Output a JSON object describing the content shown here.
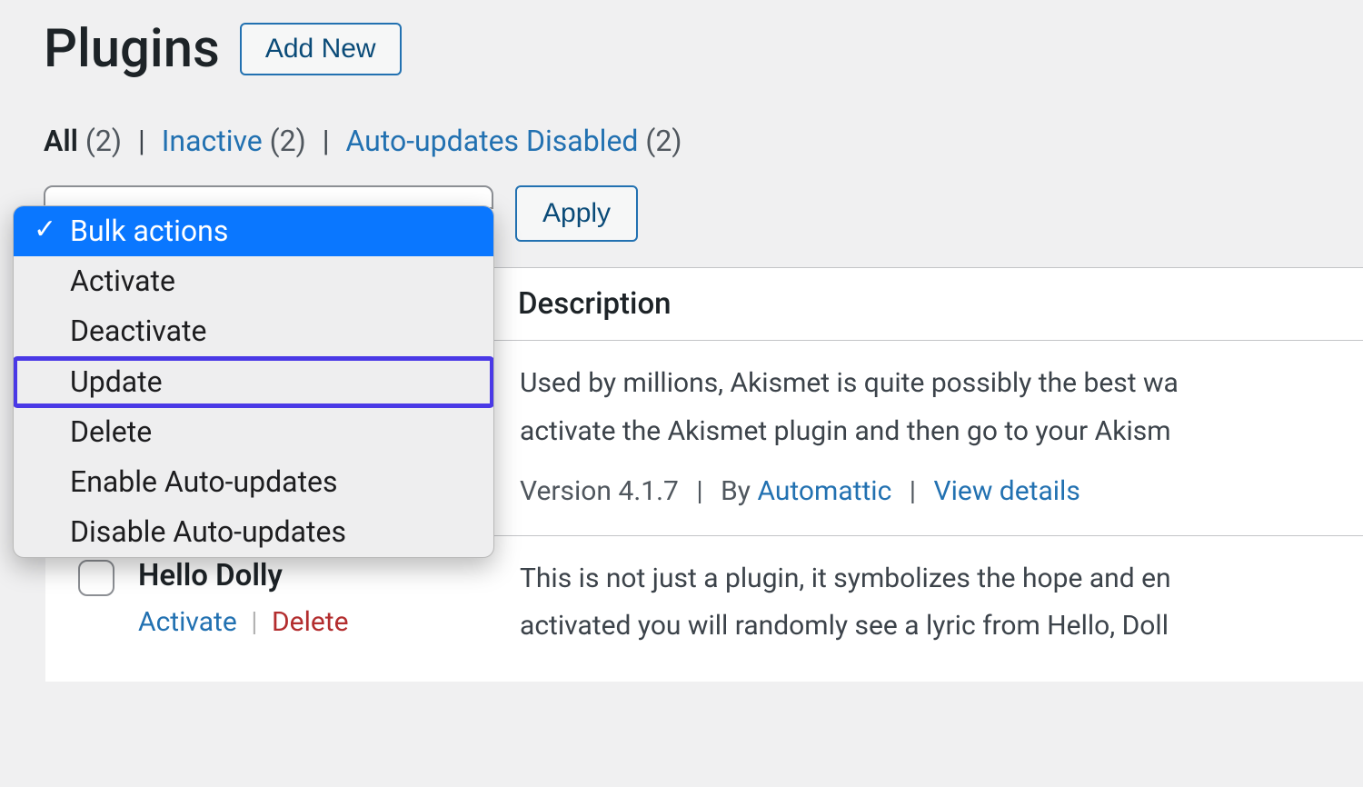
{
  "header": {
    "title": "Plugins",
    "add_new_label": "Add New"
  },
  "filters": {
    "all": {
      "label": "All",
      "count": "(2)"
    },
    "inactive": {
      "label": "Inactive",
      "count": "(2)"
    },
    "auto_updates_disabled": {
      "label": "Auto-updates Disabled",
      "count": "(2)"
    }
  },
  "bulk_actions": {
    "apply_label": "Apply",
    "options": {
      "bulk_actions": "Bulk actions",
      "activate": "Activate",
      "deactivate": "Deactivate",
      "update": "Update",
      "delete": "Delete",
      "enable_auto_updates": "Enable Auto-updates",
      "disable_auto_updates": "Disable Auto-updates"
    }
  },
  "table": {
    "header_description": "Description"
  },
  "plugins": {
    "akismet": {
      "desc_line1": "Used by millions, Akismet is quite possibly the best wa",
      "desc_line2": "activate the Akismet plugin and then go to your Akism",
      "version_prefix": "Version",
      "version": "4.1.7",
      "by_prefix": "By",
      "author": "Automattic",
      "view_details": "View details"
    },
    "hello_dolly": {
      "name": "Hello Dolly",
      "activate_label": "Activate",
      "delete_label": "Delete",
      "desc_line1": "This is not just a plugin, it symbolizes the hope and en",
      "desc_line2": "activated you will randomly see a lyric from Hello, Doll"
    }
  }
}
